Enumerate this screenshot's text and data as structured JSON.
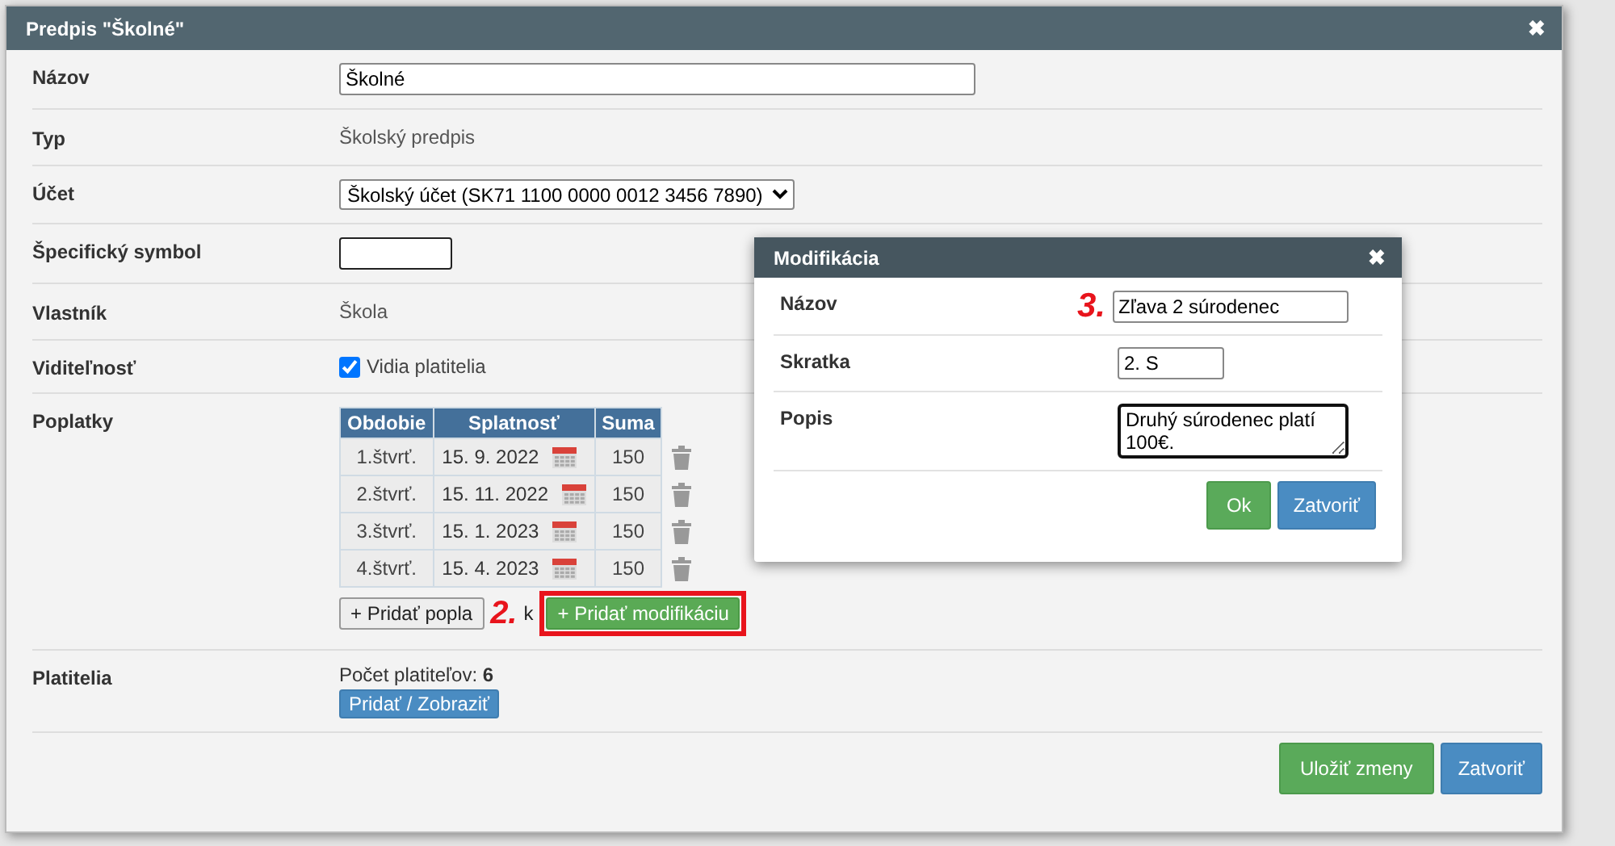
{
  "dialog": {
    "title": "Predpis \"Školné\"",
    "close": "✖"
  },
  "fields": [
    {
      "kind": "wide_input",
      "label": "Názov",
      "value": "Školné"
    },
    {
      "kind": "text",
      "label": "Typ",
      "value": "Školský predpis"
    },
    {
      "kind": "select",
      "label": "Účet",
      "value": "Školský účet (SK71 1100 0000 0012 3456 7890)"
    },
    {
      "kind": "short_input",
      "label": "Špecifický symbol"
    },
    {
      "kind": "text",
      "label": "Vlastník",
      "value": "Škola"
    },
    {
      "kind": "checkbox",
      "label": "Viditeľnosť",
      "value": "Vidia platitelia",
      "checked": true
    }
  ],
  "fees": {
    "label": "Poplatky",
    "columns": [
      "Obdobie",
      "Splatnosť",
      "Suma"
    ],
    "rows": [
      {
        "period": "1.štvrť.",
        "due": "15. 9. 2022",
        "sum": "150"
      },
      {
        "period": "2.štvrť.",
        "due": "15. 11. 2022",
        "sum": "150"
      },
      {
        "period": "3.štvrť.",
        "due": "15. 1. 2023",
        "sum": "150"
      },
      {
        "period": "4.štvrť.",
        "due": "15. 4. 2023",
        "sum": "150"
      }
    ],
    "add_button": "+ Pridať popla",
    "add_button_tail": "k",
    "marker": "2.",
    "modify_button": {
      "label": "+ Pridať modifikáciu",
      "highlighted": true
    }
  },
  "payers": {
    "label": "Platitelia",
    "count_label": "Počet platiteľov:",
    "count": "6",
    "button": "Pridať / Zobraziť"
  },
  "footer": {
    "save": "Uložiť zmeny",
    "close": "Zatvoriť"
  },
  "modal": {
    "title": "Modifikácia",
    "close": "✖",
    "marker": "3.",
    "fields": [
      {
        "kind": "wide_input",
        "label": "Názov",
        "value": "Zľava 2 súrodenec"
      },
      {
        "kind": "short_input",
        "label": "Skratka",
        "value": "2. S"
      },
      {
        "kind": "textarea",
        "label": "Popis",
        "value": "Druhý súrodenec platí 100€."
      }
    ],
    "ok": "Ok",
    "close_button": "Zatvoriť"
  }
}
